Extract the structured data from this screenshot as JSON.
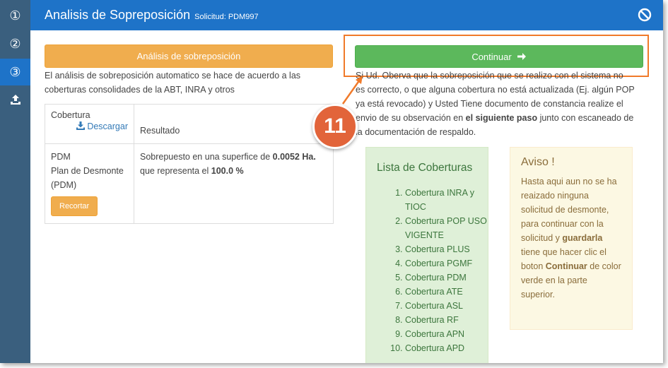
{
  "header": {
    "title": "Analisis de Sopreposición",
    "request_label": "Solicitud: PDM997"
  },
  "sidebar": {
    "steps": [
      {
        "label": "①"
      },
      {
        "label": "②"
      },
      {
        "label": "③"
      }
    ]
  },
  "left": {
    "analysis_button": "Análisis de sobreposición",
    "description": "El análisis de sobreposición automatico se hace de acuerdo a las coberturas consolidades de la ABT, INRA y otros",
    "table": {
      "col_coverage": "Cobertura",
      "download_link": "Descargar",
      "col_result": "Resultado",
      "row": {
        "coverage_line1": "PDM",
        "coverage_line2": "Plan de Desmonte (PDM)",
        "crop_button": "Recortar",
        "result_prefix": "Sobrepuesto en una superfice de ",
        "result_area": "0.0052 Ha.",
        "result_middle": " que representa el ",
        "result_percent": "100.0 %"
      }
    }
  },
  "right": {
    "continue_button": "Continuar",
    "info_part1": "Si Ud. Oberva que la sobreposición que se realizo con el sistema no es correcto, o que alguna cobertura no está actualizada (Ej. algún POP ya está revocado) y Usted Tiene documento de constancia realize el envio de su observación en ",
    "info_bold": "el siguiente paso",
    "info_part2": " junto con escaneado de la documentación de respaldo."
  },
  "annotation": {
    "step_number": "11",
    "accent_color": "#e2643a"
  },
  "coverages": {
    "title": "Lista de Coberturas",
    "items": [
      "Cobertura INRA y TIOC",
      "Cobertura POP USO VIGENTE",
      "Cobertura PLUS",
      "Cobertura PGMF",
      "Cobertura PDM",
      "Cobertura ATE",
      "Cobertura ASL",
      "Cobertura RF",
      "Cobertura APN",
      "Cobertura APD"
    ]
  },
  "notice": {
    "title": "Aviso !",
    "text_part1": "Hasta aqui aun no se ha reaizado ninguna solicitud de desmonte, para continuar con la solicitud y ",
    "bold1": "guardarla",
    "text_part2": " tiene que hacer clic el boton ",
    "bold2": "Continuar",
    "text_part3": " de color verde en la parte superior."
  },
  "colors": {
    "primary": "#1e73c8",
    "sidebar": "#3a5f7e",
    "warning": "#f0ad4e",
    "success": "#5cb85c"
  }
}
